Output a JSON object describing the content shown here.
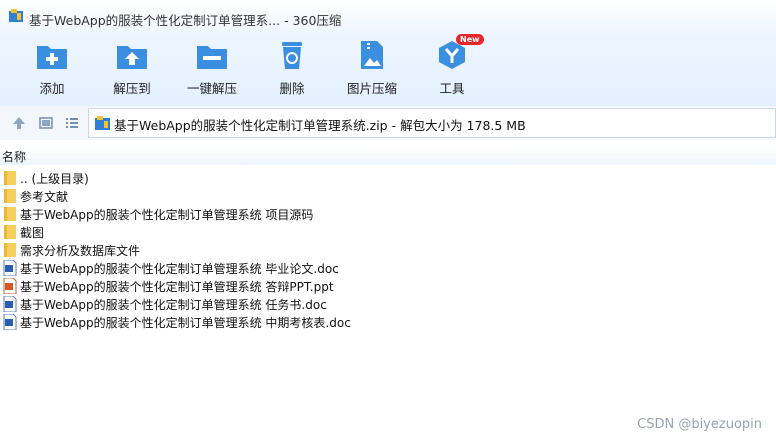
{
  "window": {
    "title": "基于WebApp的服装个性化定制订单管理系... - 360压缩",
    "icon": "archive-app-icon"
  },
  "toolbar": [
    {
      "label": "添加",
      "icon": "add-icon",
      "color": "#3a8fe0"
    },
    {
      "label": "解压到",
      "icon": "extract-to-icon",
      "color": "#3a8fe0"
    },
    {
      "label": "一键解压",
      "icon": "one-click-extract-icon",
      "color": "#3a8fe0"
    },
    {
      "label": "删除",
      "icon": "delete-icon",
      "color": "#3a8fe0"
    },
    {
      "label": "图片压缩",
      "icon": "image-compress-icon",
      "color": "#3a8fe0"
    },
    {
      "label": "工具",
      "icon": "tools-icon",
      "color": "#3a8fe0",
      "badge": "New"
    }
  ],
  "address": {
    "path": "基于WebApp的服装个性化定制订单管理系统.zip - 解包大小为 178.5 MB"
  },
  "list": {
    "column_name": "名称",
    "items": [
      {
        "name": ".. (上级目录)",
        "type": "folder"
      },
      {
        "name": "参考文献",
        "type": "folder"
      },
      {
        "name": "基于WebApp的服装个性化定制订单管理系统 项目源码",
        "type": "folder"
      },
      {
        "name": "截图",
        "type": "folder"
      },
      {
        "name": "需求分析及数据库文件",
        "type": "folder"
      },
      {
        "name": "基于WebApp的服装个性化定制订单管理系统 毕业论文.doc",
        "type": "doc"
      },
      {
        "name": "基于WebApp的服装个性化定制订单管理系统 答辩PPT.ppt",
        "type": "ppt"
      },
      {
        "name": "基于WebApp的服装个性化定制订单管理系统 任务书.doc",
        "type": "doc"
      },
      {
        "name": "基于WebApp的服装个性化定制订单管理系统 中期考核表.doc",
        "type": "doc"
      }
    ]
  },
  "watermark": "CSDN @biyezuopin",
  "colors": {
    "accent": "#3a8fe0",
    "badge": "#e8262b",
    "folder": "#f7cf5c"
  }
}
